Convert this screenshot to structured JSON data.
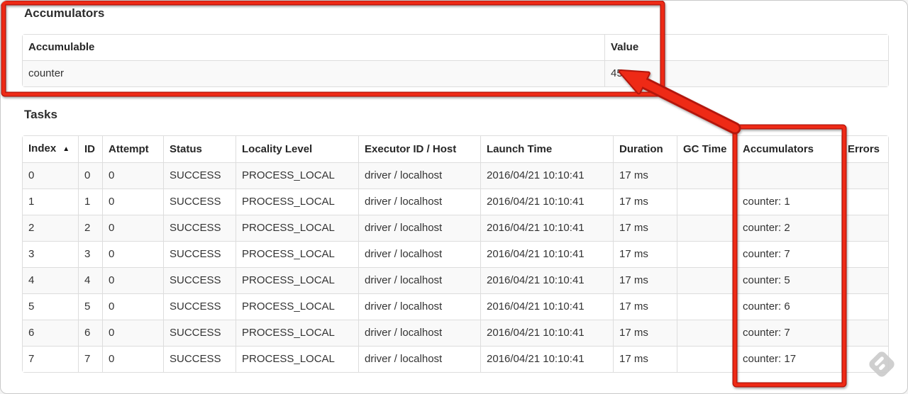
{
  "accumulators_section": {
    "title": "Accumulators",
    "table": {
      "columns": [
        "Accumulable",
        "Value"
      ],
      "rows": [
        {
          "accumulable": "counter",
          "value": "45"
        }
      ]
    }
  },
  "tasks_section": {
    "title": "Tasks",
    "table": {
      "columns": [
        "Index",
        "ID",
        "Attempt",
        "Status",
        "Locality Level",
        "Executor ID / Host",
        "Launch Time",
        "Duration",
        "GC Time",
        "Accumulators",
        "Errors"
      ],
      "sort": {
        "column": "Index",
        "direction": "ascending",
        "icon": "▲"
      },
      "rows": [
        {
          "index": "0",
          "id": "0",
          "attempt": "0",
          "status": "SUCCESS",
          "locality_level": "PROCESS_LOCAL",
          "executor_id_host": "driver / localhost",
          "launch_time": "2016/04/21 10:10:41",
          "duration": "17 ms",
          "gc_time": "",
          "accumulators": "",
          "errors": ""
        },
        {
          "index": "1",
          "id": "1",
          "attempt": "0",
          "status": "SUCCESS",
          "locality_level": "PROCESS_LOCAL",
          "executor_id_host": "driver / localhost",
          "launch_time": "2016/04/21 10:10:41",
          "duration": "17 ms",
          "gc_time": "",
          "accumulators": "counter: 1",
          "errors": ""
        },
        {
          "index": "2",
          "id": "2",
          "attempt": "0",
          "status": "SUCCESS",
          "locality_level": "PROCESS_LOCAL",
          "executor_id_host": "driver / localhost",
          "launch_time": "2016/04/21 10:10:41",
          "duration": "17 ms",
          "gc_time": "",
          "accumulators": "counter: 2",
          "errors": ""
        },
        {
          "index": "3",
          "id": "3",
          "attempt": "0",
          "status": "SUCCESS",
          "locality_level": "PROCESS_LOCAL",
          "executor_id_host": "driver / localhost",
          "launch_time": "2016/04/21 10:10:41",
          "duration": "17 ms",
          "gc_time": "",
          "accumulators": "counter: 7",
          "errors": ""
        },
        {
          "index": "4",
          "id": "4",
          "attempt": "0",
          "status": "SUCCESS",
          "locality_level": "PROCESS_LOCAL",
          "executor_id_host": "driver / localhost",
          "launch_time": "2016/04/21 10:10:41",
          "duration": "17 ms",
          "gc_time": "",
          "accumulators": "counter: 5",
          "errors": ""
        },
        {
          "index": "5",
          "id": "5",
          "attempt": "0",
          "status": "SUCCESS",
          "locality_level": "PROCESS_LOCAL",
          "executor_id_host": "driver / localhost",
          "launch_time": "2016/04/21 10:10:41",
          "duration": "17 ms",
          "gc_time": "",
          "accumulators": "counter: 6",
          "errors": ""
        },
        {
          "index": "6",
          "id": "6",
          "attempt": "0",
          "status": "SUCCESS",
          "locality_level": "PROCESS_LOCAL",
          "executor_id_host": "driver / localhost",
          "launch_time": "2016/04/21 10:10:41",
          "duration": "17 ms",
          "gc_time": "",
          "accumulators": "counter: 7",
          "errors": ""
        },
        {
          "index": "7",
          "id": "7",
          "attempt": "0",
          "status": "SUCCESS",
          "locality_level": "PROCESS_LOCAL",
          "executor_id_host": "driver / localhost",
          "launch_time": "2016/04/21 10:10:41",
          "duration": "17 ms",
          "gc_time": "",
          "accumulators": "counter: 17",
          "errors": ""
        }
      ]
    }
  },
  "annotations": {
    "color": "#ee2b15",
    "outline_color": "#b21508"
  },
  "watermark": {
    "icon": "stamp-icon",
    "color": "#cbcbcb",
    "stripe_color": "#ffffff"
  }
}
